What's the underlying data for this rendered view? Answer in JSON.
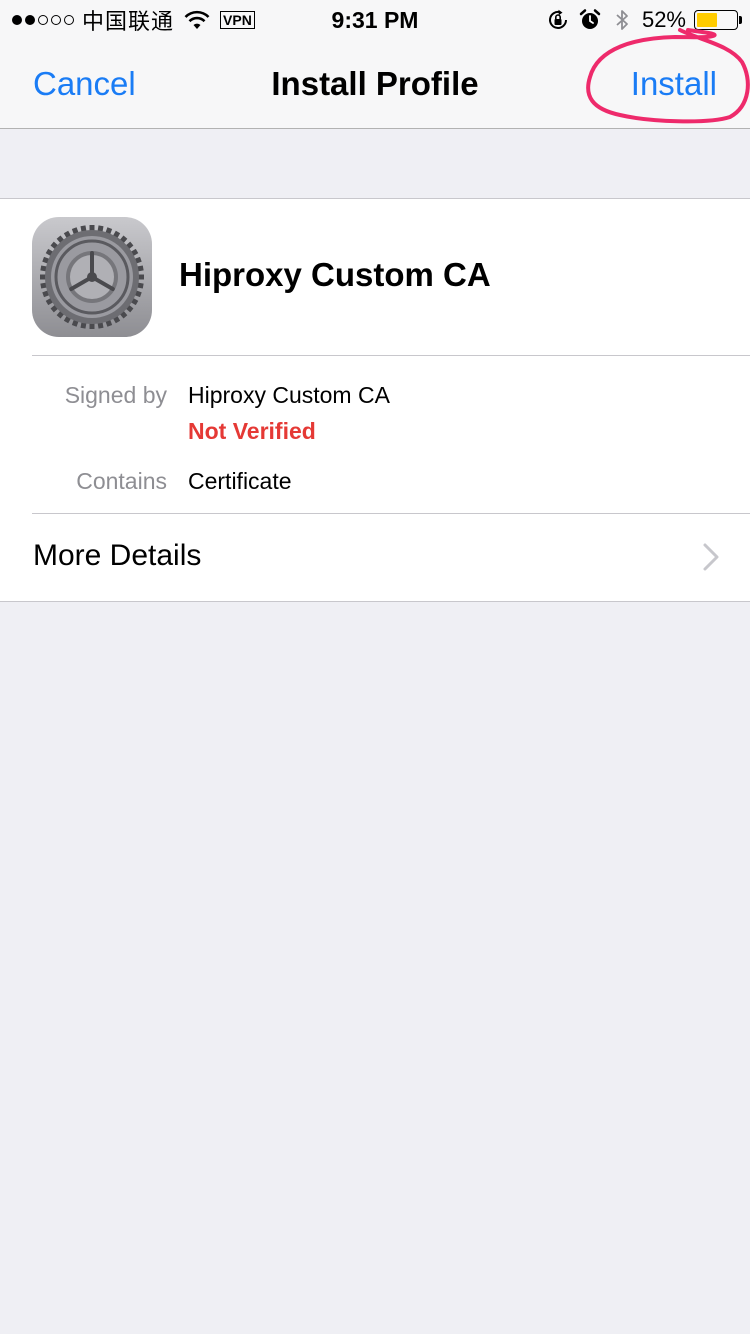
{
  "status_bar": {
    "carrier": "中国联通",
    "vpn": "VPN",
    "time": "9:31 PM",
    "battery_percent": "52%",
    "battery_level": 0.52,
    "signal_strength": 2,
    "icons": [
      "wifi-icon",
      "orientation-lock-icon",
      "alarm-icon",
      "bluetooth-icon",
      "battery-icon"
    ]
  },
  "nav": {
    "cancel_label": "Cancel",
    "title": "Install Profile",
    "install_label": "Install"
  },
  "profile": {
    "icon": "settings-gear-icon",
    "name": "Hiproxy Custom CA",
    "signed_by_label": "Signed by",
    "signed_by_value": "Hiproxy Custom CA",
    "verification_status": "Not Verified",
    "contains_label": "Contains",
    "contains_value": "Certificate",
    "more_details_label": "More Details"
  },
  "colors": {
    "accent": "#1a7cf5",
    "warning": "#e53935",
    "annotation": "#ee2a6b",
    "battery": "#ffcc00"
  }
}
